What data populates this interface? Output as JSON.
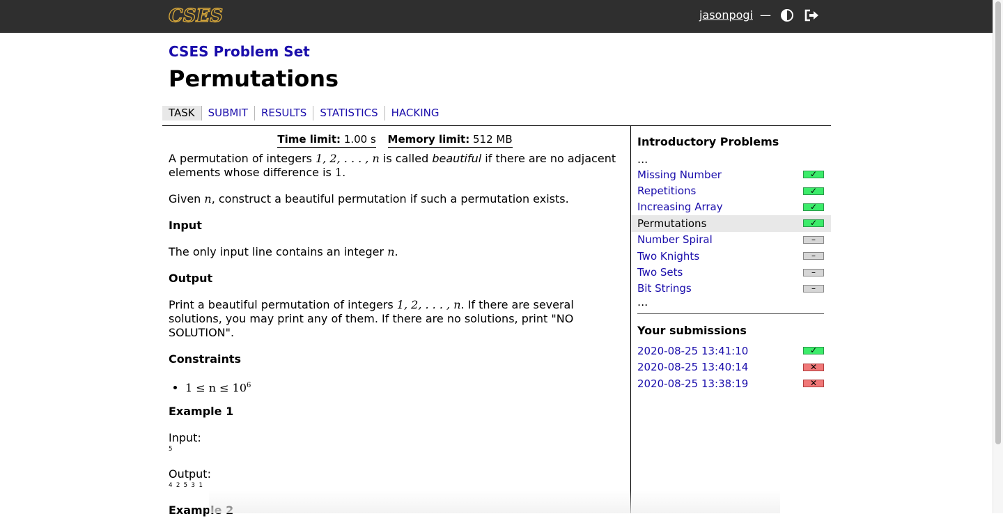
{
  "header": {
    "logo": "CSES",
    "username": "jasonpogi",
    "separator": "—",
    "theme_icon": "contrast-icon",
    "logout_icon": "logout-icon"
  },
  "title": {
    "set": "CSES Problem Set",
    "problem": "Permutations"
  },
  "nav": {
    "tabs": [
      {
        "label": "TASK"
      },
      {
        "label": "SUBMIT"
      },
      {
        "label": "RESULTS"
      },
      {
        "label": "STATISTICS"
      },
      {
        "label": "HACKING"
      }
    ]
  },
  "limits": {
    "time_label": "Time limit:",
    "time_value": "1.00 s",
    "memory_label": "Memory limit:",
    "memory_value": "512 MB"
  },
  "statement": {
    "p1_a": "A permutation of integers ",
    "p1_math": "1, 2, . . . , n",
    "p1_b": " is called ",
    "p1_em": "beautiful",
    "p1_c": " if there are no adjacent elements whose difference is ",
    "p1_d": ".",
    "p1_one": "1",
    "p2_a": "Given ",
    "p2_math": "n",
    "p2_b": ", construct a beautiful permutation if such a permutation exists.",
    "input_h": "Input",
    "input_a": "The only input line contains an integer ",
    "input_math": "n",
    "input_b": ".",
    "output_h": "Output",
    "output_a": "Print a beautiful permutation of integers ",
    "output_math": "1, 2, . . . , n",
    "output_b": ". If there are several solutions, you may print any of them. If there are no solutions, print \"NO SOLUTION\".",
    "constraints_h": "Constraints",
    "constraint_1": "1 ≤ n ≤ 10",
    "constraint_1_sup": "6",
    "ex1_h": "Example 1",
    "ex1_input_label": "Input:",
    "ex1_input": "5",
    "ex1_output_label": "Output:",
    "ex1_output": "4 2 5 3 1",
    "ex2_h": "Example 2"
  },
  "sidebar": {
    "section_title": "Introductory Problems",
    "ellipsis": "...",
    "tasks": [
      {
        "name": "Missing Number",
        "status": "done",
        "glyph": "✓"
      },
      {
        "name": "Repetitions",
        "status": "done",
        "glyph": "✓"
      },
      {
        "name": "Increasing Array",
        "status": "done",
        "glyph": "✓"
      },
      {
        "name": "Permutations",
        "status": "done",
        "glyph": "✓"
      },
      {
        "name": "Number Spiral",
        "status": "none",
        "glyph": "–"
      },
      {
        "name": "Two Knights",
        "status": "none",
        "glyph": "–"
      },
      {
        "name": "Two Sets",
        "status": "none",
        "glyph": "–"
      },
      {
        "name": "Bit Strings",
        "status": "none",
        "glyph": "–"
      }
    ],
    "submissions_title": "Your submissions",
    "submissions": [
      {
        "time": "2020-08-25 13:41:10",
        "status": "done",
        "glyph": "✓"
      },
      {
        "time": "2020-08-25 13:40:14",
        "status": "fail",
        "glyph": "✕"
      },
      {
        "time": "2020-08-25 13:38:19",
        "status": "fail",
        "glyph": "✕"
      }
    ]
  },
  "colors": {
    "link": "#1a0dab",
    "accepted": "#3cec6a",
    "rejected": "#f07878",
    "untried": "#d6d6d6",
    "header_bg": "#2f2f2f",
    "logo_gold": "#d2a43a"
  }
}
